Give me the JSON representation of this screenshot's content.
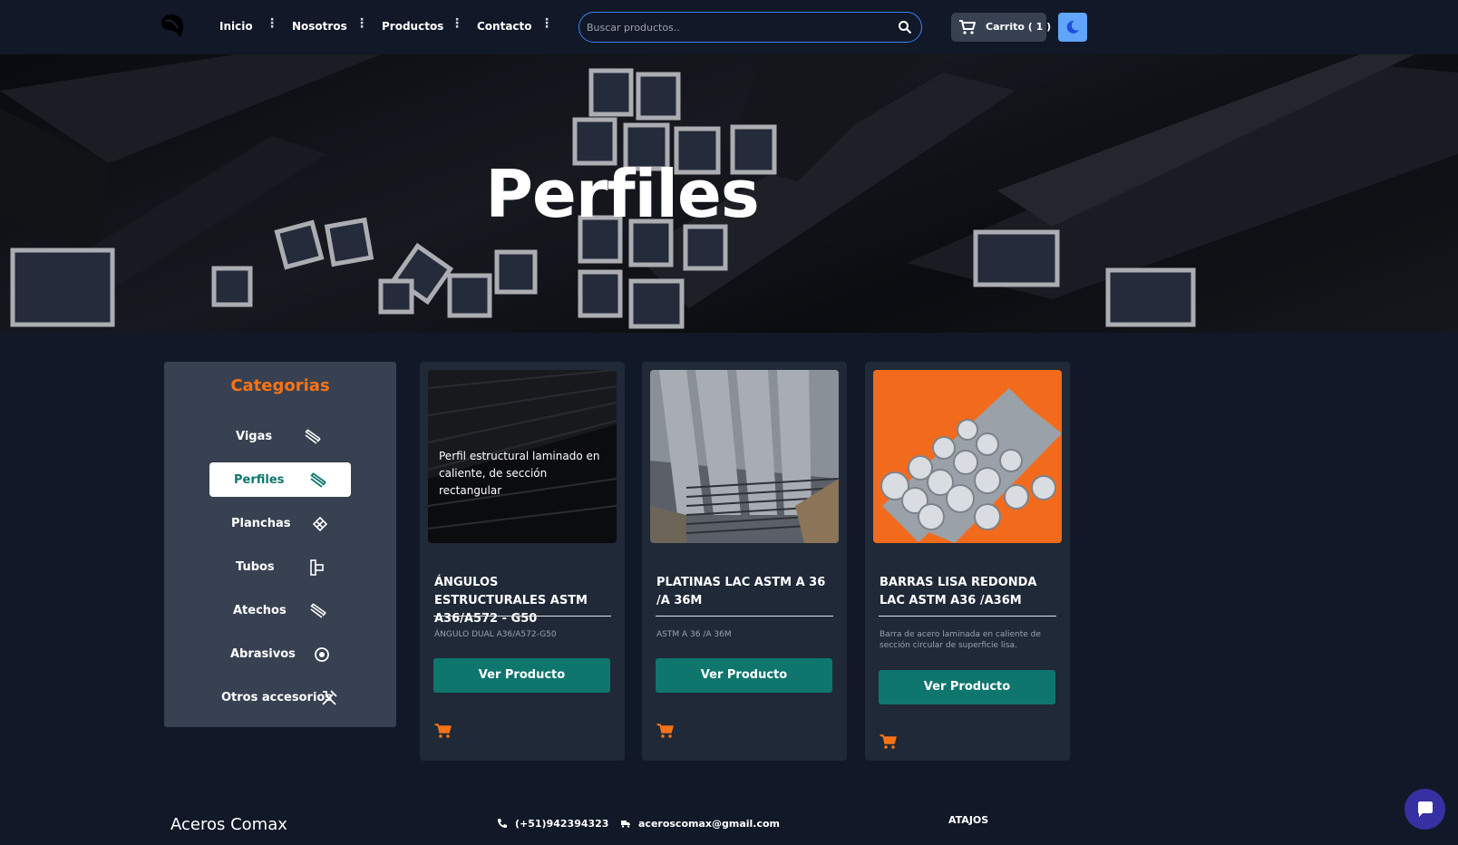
{
  "nav": {
    "links": [
      "Inicio",
      "Nosotros",
      "Productos",
      "Contacto"
    ],
    "search_placeholder": "Buscar productos..",
    "cart_label": "Carrito ( 1 )"
  },
  "hero": {
    "title": "Perfiles"
  },
  "sidebar": {
    "title": "Categorias",
    "items": [
      {
        "label": "Vigas",
        "icon": "beam-icon"
      },
      {
        "label": "Perfiles",
        "icon": "profile-icon",
        "active": true
      },
      {
        "label": "Planchas",
        "icon": "plate-icon"
      },
      {
        "label": "Tubos",
        "icon": "pipe-icon"
      },
      {
        "label": "Atechos",
        "icon": "roof-sheet-icon"
      },
      {
        "label": "Abrasivos",
        "icon": "disc-icon"
      },
      {
        "label": "Otros accesorios",
        "icon": "tools-icon"
      }
    ]
  },
  "products": [
    {
      "overlay": "Perfil estructural laminado en caliente, de sección rectangular",
      "title": "ÁNGULOS ESTRUCTURALES ASTM A36/A572 - G50",
      "desc": "ÁNGULO DUAL A36/A572-G50",
      "button": "Ver Producto"
    },
    {
      "overlay": "",
      "title": "PLATINAS LAC ASTM A 36 /A 36M",
      "desc": "ASTM A 36 /A 36M",
      "button": "Ver Producto"
    },
    {
      "overlay": "",
      "title": "BARRAS LISA REDONDA LAC ASTM A36 /A36M",
      "desc": "Barra de acero laminada en caliente de sección circular de superficie lisa.",
      "button": "Ver Producto"
    }
  ],
  "footer": {
    "brand": "Aceros Comax",
    "phone": "(+51)942394323",
    "email": "aceroscomax@gmail.com",
    "shortcuts_title": "ATAJOS"
  },
  "colors": {
    "background": "#111827",
    "accent_orange": "#f97316",
    "button_teal": "#0f766e",
    "search_border": "#3b82f6"
  }
}
